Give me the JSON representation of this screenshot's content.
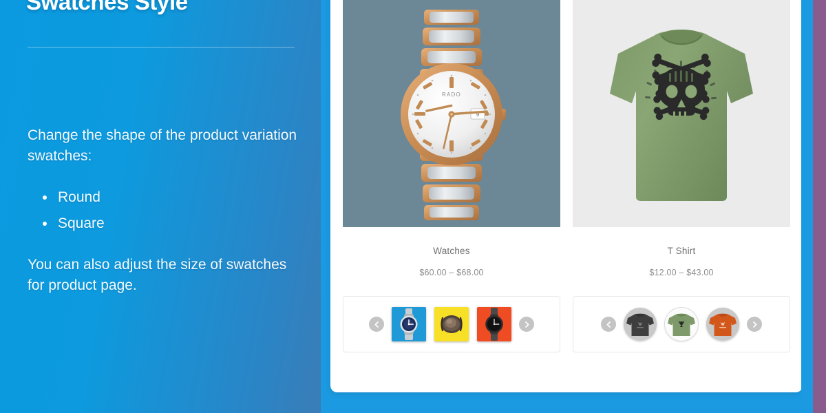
{
  "slide": {
    "panel": {
      "title": "Swatches Style",
      "paragraph_1": "Change the shape of the product variation swatches:",
      "options": [
        {
          "label": "Round"
        },
        {
          "label": "Square"
        }
      ],
      "paragraph_2": "You can also adjust the size of swatches for product page."
    },
    "colors": {
      "panel_gradient_start": "#0b9ae0",
      "panel_gradient_end": "#3a7db7",
      "slide_background": "#1b9ae2",
      "edge_strip_blue": "#1b9ae2",
      "edge_strip_purple": "#8a5c8e",
      "card_background": "#ffffff"
    },
    "products": [
      {
        "title": "Watches",
        "price": "$60.00 – $68.00",
        "image_background": "#6c8795",
        "image_alt": "rose-gold-and-silver-wrist-watch",
        "swatch_style": "square",
        "prev_label": "Previous",
        "next_label": "Next",
        "swatches": [
          {
            "name": "blue-watch-swatch",
            "background": "#1f9ad6",
            "selected": false
          },
          {
            "name": "yellow-watch-swatch",
            "background": "#f7e025",
            "selected": false
          },
          {
            "name": "orange-watch-swatch",
            "background": "#f04c23",
            "selected": false
          }
        ]
      },
      {
        "title": "T Shirt",
        "price": "$12.00 – $43.00",
        "image_background": "#ebebeb",
        "image_alt": "olive-green-skull-graphic-t-shirt",
        "swatch_style": "round",
        "prev_label": "Previous",
        "next_label": "Next",
        "swatches": [
          {
            "name": "charcoal-shirt-swatch",
            "background": "#c9c9c9",
            "shirt_color": "#3e3e3e",
            "selected": false
          },
          {
            "name": "green-shirt-swatch",
            "background": "#fbfbfb",
            "shirt_color": "#7e9a6a",
            "selected": true
          },
          {
            "name": "orange-shirt-swatch",
            "background": "#c9c9c9",
            "shirt_color": "#d2571b",
            "selected": false
          }
        ]
      }
    ]
  }
}
